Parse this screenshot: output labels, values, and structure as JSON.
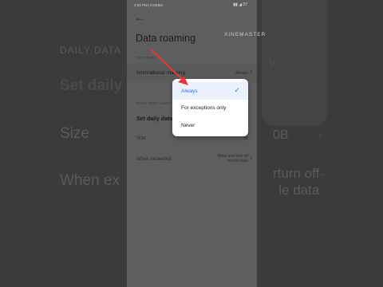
{
  "status_bar": {
    "time": "2:54 PM | 0.0KB/s",
    "icons": "▮▮ ◢ 37"
  },
  "watermark": "XINEMASTER",
  "header": {
    "title": "Data roaming"
  },
  "settings_section": {
    "label": "SETTINGS",
    "international_roaming": {
      "label": "International roaming",
      "value": "Always"
    }
  },
  "daily_section": {
    "label": "DAILY DATA LIMIT",
    "set_daily_label": "Set daily data",
    "size": {
      "label": "Size",
      "value": "0B"
    },
    "when_exceeded": {
      "label": "When exceeded",
      "value_line1": "Warn and turn off",
      "value_line2": "mobile data"
    }
  },
  "dropdown": {
    "options": [
      {
        "label": "Always",
        "selected": true
      },
      {
        "label": "For exceptions only",
        "selected": false
      },
      {
        "label": "Never",
        "selected": false
      }
    ]
  },
  "background_copy": {
    "section": "DAILY DATA",
    "set_daily": "Set daily",
    "size": "Size",
    "when": "When ex",
    "right1": "y",
    "right2": "0B",
    "right3_line1": "rturn off",
    "right3_line2": "le data"
  },
  "colors": {
    "accent": "#2f6ee0",
    "annotation": "#e53935",
    "selected_bg": "#eaf1fc"
  }
}
